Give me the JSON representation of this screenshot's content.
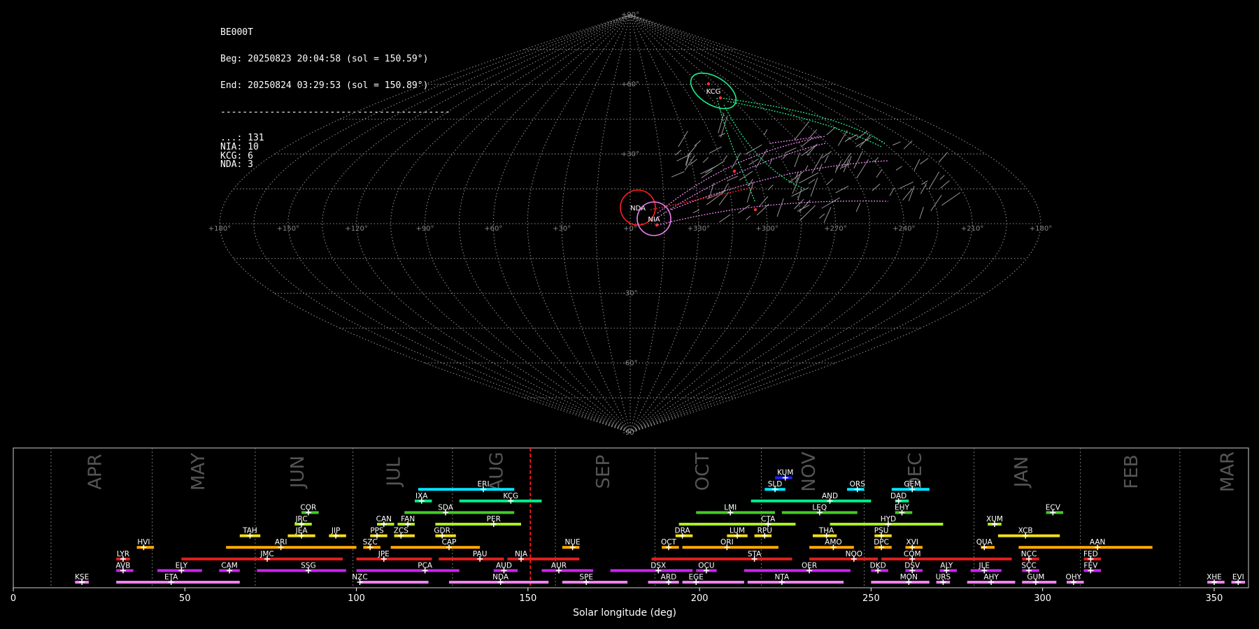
{
  "info_box": {
    "station": "BE000T",
    "begin": "Beg: 20250823 20:04:58 (sol = 150.59°)",
    "end": "End: 20250824 03:29:53 (sol = 150.89°)",
    "separator": "------------------------------------------",
    "counts": [
      {
        "code": "...",
        "count": 131
      },
      {
        "code": "NIA",
        "count": 10
      },
      {
        "code": "KCG",
        "count": 6
      },
      {
        "code": "NDA",
        "count": 3
      }
    ]
  },
  "sky_map": {
    "projection": "sinusoidal",
    "lat_labels": [
      "+90°",
      "+60°",
      "+30°",
      "-30°",
      "-60°",
      "-90°"
    ],
    "lon_labels": [
      "+180°",
      "+150°",
      "+120°",
      "+90°",
      "+60°",
      "+30°",
      "+0°",
      "+330°",
      "+300°",
      "+270°",
      "+240°",
      "+210°",
      "+180°"
    ],
    "radiants": [
      {
        "code": "NDA",
        "color": "#ff2020"
      },
      {
        "code": "NIA",
        "color": "#ee82ee"
      },
      {
        "code": "KCG",
        "color": "#22ee88"
      }
    ]
  },
  "chart_data": {
    "type": "timeline",
    "xlabel": "Solar longitude (deg)",
    "xlim": [
      0,
      360
    ],
    "xticks": [
      0,
      50,
      100,
      150,
      200,
      250,
      300,
      350
    ],
    "current_sol": 150.7,
    "months": [
      {
        "name": "APR",
        "boundary": 11,
        "center": 24
      },
      {
        "name": "MAY",
        "boundary": 40.5,
        "center": 54
      },
      {
        "name": "JUN",
        "boundary": 70.5,
        "center": 83
      },
      {
        "name": "JUL",
        "boundary": 99,
        "center": 111
      },
      {
        "name": "AUG",
        "boundary": 128,
        "center": 141
      },
      {
        "name": "SEP",
        "boundary": 158,
        "center": 172
      },
      {
        "name": "OCT",
        "boundary": 187,
        "center": 201
      },
      {
        "name": "NOV",
        "boundary": 218,
        "center": 232
      },
      {
        "name": "DEC",
        "boundary": 248,
        "center": 263
      },
      {
        "name": "JAN",
        "boundary": 280,
        "center": 294
      },
      {
        "name": "FEB",
        "boundary": 311,
        "center": 326
      },
      {
        "name": "MAR",
        "boundary": 340,
        "center": 354
      }
    ],
    "showers": [
      {
        "code": "KUM",
        "start": 222,
        "end": 227,
        "peak": 225,
        "row": 9,
        "color": "#2020ff"
      },
      {
        "code": "ERI",
        "start": 118,
        "end": 146,
        "peak": 137,
        "row": 8,
        "color": "#00e5ff"
      },
      {
        "code": "SLD",
        "start": 219,
        "end": 225,
        "peak": 222,
        "row": 8,
        "color": "#00e5ff"
      },
      {
        "code": "ORS",
        "start": 243,
        "end": 248,
        "peak": 246,
        "row": 8,
        "color": "#00e5ff"
      },
      {
        "code": "GEM",
        "start": 256,
        "end": 267,
        "peak": 262,
        "row": 8,
        "color": "#00e5ff"
      },
      {
        "code": "IXA",
        "start": 117,
        "end": 122,
        "peak": 119,
        "row": 7,
        "color": "#00ee88"
      },
      {
        "code": "KCG",
        "start": 130,
        "end": 154,
        "peak": 145,
        "row": 7,
        "color": "#00ee88"
      },
      {
        "code": "AND",
        "start": 215,
        "end": 250,
        "peak": 238,
        "row": 7,
        "color": "#00ee88"
      },
      {
        "code": "DAD",
        "start": 257,
        "end": 261,
        "peak": 258,
        "row": 7,
        "color": "#00ee88"
      },
      {
        "code": "COR",
        "start": 84,
        "end": 89,
        "peak": 86,
        "row": 6,
        "color": "#44cc22"
      },
      {
        "code": "SDA",
        "start": 114,
        "end": 146,
        "peak": 126,
        "row": 6,
        "color": "#44cc22"
      },
      {
        "code": "LMI",
        "start": 199,
        "end": 222,
        "peak": 209,
        "row": 6,
        "color": "#44cc22"
      },
      {
        "code": "LEQ",
        "start": 224,
        "end": 246,
        "peak": 235,
        "row": 6,
        "color": "#44cc22"
      },
      {
        "code": "EHY",
        "start": 257,
        "end": 262,
        "peak": 259,
        "row": 6,
        "color": "#44cc22"
      },
      {
        "code": "ECV",
        "start": 301,
        "end": 306,
        "peak": 303,
        "row": 6,
        "color": "#44cc22"
      },
      {
        "code": "JRC",
        "start": 82,
        "end": 87,
        "peak": 84,
        "row": 5,
        "color": "#aaee22"
      },
      {
        "code": "CAN",
        "start": 106,
        "end": 111,
        "peak": 108,
        "row": 5,
        "color": "#aaee22"
      },
      {
        "code": "FAN",
        "start": 112,
        "end": 117,
        "peak": 115,
        "row": 5,
        "color": "#aaee22"
      },
      {
        "code": "PER",
        "start": 123,
        "end": 148,
        "peak": 140,
        "row": 5,
        "color": "#aaee22"
      },
      {
        "code": "CTA",
        "start": 194,
        "end": 228,
        "peak": 220,
        "row": 5,
        "color": "#aaee22"
      },
      {
        "code": "HYD",
        "start": 238,
        "end": 271,
        "peak": 255,
        "row": 5,
        "color": "#aaee22"
      },
      {
        "code": "XUM",
        "start": 284,
        "end": 288,
        "peak": 286,
        "row": 5,
        "color": "#aaee22"
      },
      {
        "code": "TAH",
        "start": 66,
        "end": 72,
        "peak": 69,
        "row": 4,
        "color": "#f2e01a"
      },
      {
        "code": "JEA",
        "start": 80,
        "end": 88,
        "peak": 84,
        "row": 4,
        "color": "#f2e01a"
      },
      {
        "code": "JIP",
        "start": 92,
        "end": 97,
        "peak": 94,
        "row": 4,
        "color": "#f2e01a"
      },
      {
        "code": "PPS",
        "start": 104,
        "end": 109,
        "peak": 106,
        "row": 4,
        "color": "#f2e01a"
      },
      {
        "code": "ZCS",
        "start": 111,
        "end": 117,
        "peak": 113,
        "row": 4,
        "color": "#f2e01a"
      },
      {
        "code": "GDR",
        "start": 123,
        "end": 129,
        "peak": 125,
        "row": 4,
        "color": "#f2e01a"
      },
      {
        "code": "DRA",
        "start": 193,
        "end": 198,
        "peak": 195,
        "row": 4,
        "color": "#f2e01a"
      },
      {
        "code": "LUM",
        "start": 208,
        "end": 214,
        "peak": 211,
        "row": 4,
        "color": "#f2e01a"
      },
      {
        "code": "RPU",
        "start": 216,
        "end": 221,
        "peak": 219,
        "row": 4,
        "color": "#f2e01a"
      },
      {
        "code": "THA",
        "start": 233,
        "end": 240,
        "peak": 237,
        "row": 4,
        "color": "#f2e01a"
      },
      {
        "code": "PSU",
        "start": 251,
        "end": 256,
        "peak": 253,
        "row": 4,
        "color": "#f2e01a"
      },
      {
        "code": "XCB",
        "start": 287,
        "end": 305,
        "peak": 295,
        "row": 4,
        "color": "#f2e01a"
      },
      {
        "code": "HVI",
        "start": 36,
        "end": 41,
        "peak": 38,
        "row": 3,
        "color": "#ffaa00"
      },
      {
        "code": "ARI",
        "start": 62,
        "end": 100,
        "peak": 78,
        "row": 3,
        "color": "#ffaa00"
      },
      {
        "code": "SZC",
        "start": 102,
        "end": 107,
        "peak": 104,
        "row": 3,
        "color": "#ffaa00"
      },
      {
        "code": "CAP",
        "start": 110,
        "end": 136,
        "peak": 127,
        "row": 3,
        "color": "#ffaa00"
      },
      {
        "code": "NUE",
        "start": 160,
        "end": 165,
        "peak": 163,
        "row": 3,
        "color": "#ffaa00"
      },
      {
        "code": "OCT",
        "start": 189,
        "end": 194,
        "peak": 191,
        "row": 3,
        "color": "#ffaa00"
      },
      {
        "code": "ORI",
        "start": 195,
        "end": 223,
        "peak": 208,
        "row": 3,
        "color": "#ffaa00"
      },
      {
        "code": "AMO",
        "start": 232,
        "end": 245,
        "peak": 239,
        "row": 3,
        "color": "#ffaa00"
      },
      {
        "code": "DPC",
        "start": 251,
        "end": 256,
        "peak": 253,
        "row": 3,
        "color": "#ffaa00"
      },
      {
        "code": "XVI",
        "start": 260,
        "end": 265,
        "peak": 262,
        "row": 3,
        "color": "#ffaa00"
      },
      {
        "code": "QUA",
        "start": 282,
        "end": 286,
        "peak": 283,
        "row": 3,
        "color": "#ffaa00"
      },
      {
        "code": "AAN",
        "start": 293,
        "end": 332,
        "peak": 316,
        "row": 3,
        "color": "#ffaa00"
      },
      {
        "code": "LYR",
        "start": 30,
        "end": 34,
        "peak": 32,
        "row": 2,
        "color": "#e02020"
      },
      {
        "code": "JMC",
        "start": 49,
        "end": 96,
        "peak": 74,
        "row": 2,
        "color": "#e02020"
      },
      {
        "code": "JPE",
        "start": 100,
        "end": 122,
        "peak": 108,
        "row": 2,
        "color": "#e02020"
      },
      {
        "code": "PAU",
        "start": 124,
        "end": 143,
        "peak": 136,
        "row": 2,
        "color": "#e02020"
      },
      {
        "code": "NIA",
        "start": 144,
        "end": 165,
        "peak": 148,
        "row": 2,
        "color": "#e02020"
      },
      {
        "code": "STA",
        "start": 186,
        "end": 227,
        "peak": 216,
        "row": 2,
        "color": "#e02020"
      },
      {
        "code": "NOO",
        "start": 232,
        "end": 252,
        "peak": 245,
        "row": 2,
        "color": "#e02020"
      },
      {
        "code": "COM",
        "start": 253,
        "end": 291,
        "peak": 262,
        "row": 2,
        "color": "#e02020"
      },
      {
        "code": "NCC",
        "start": 294,
        "end": 299,
        "peak": 296,
        "row": 2,
        "color": "#e02020"
      },
      {
        "code": "FED",
        "start": 312,
        "end": 317,
        "peak": 314,
        "row": 2,
        "color": "#e02020"
      },
      {
        "code": "AVB",
        "start": 30,
        "end": 35,
        "peak": 32,
        "row": 1,
        "color": "#cc22ee"
      },
      {
        "code": "ELY",
        "start": 42,
        "end": 55,
        "peak": 49,
        "row": 1,
        "color": "#cc22ee"
      },
      {
        "code": "CAM",
        "start": 60,
        "end": 66,
        "peak": 63,
        "row": 1,
        "color": "#cc22ee"
      },
      {
        "code": "SSG",
        "start": 71,
        "end": 97,
        "peak": 86,
        "row": 1,
        "color": "#cc22ee"
      },
      {
        "code": "PCA",
        "start": 100,
        "end": 130,
        "peak": 120,
        "row": 1,
        "color": "#cc22ee"
      },
      {
        "code": "AUD",
        "start": 140,
        "end": 147,
        "peak": 143,
        "row": 1,
        "color": "#cc22ee"
      },
      {
        "code": "AUR",
        "start": 154,
        "end": 169,
        "peak": 159,
        "row": 1,
        "color": "#cc22ee"
      },
      {
        "code": "DSX",
        "start": 174,
        "end": 198,
        "peak": 188,
        "row": 1,
        "color": "#cc22ee"
      },
      {
        "code": "OCU",
        "start": 199,
        "end": 205,
        "peak": 202,
        "row": 1,
        "color": "#cc22ee"
      },
      {
        "code": "OER",
        "start": 213,
        "end": 244,
        "peak": 232,
        "row": 1,
        "color": "#cc22ee"
      },
      {
        "code": "DKD",
        "start": 250,
        "end": 255,
        "peak": 252,
        "row": 1,
        "color": "#cc22ee"
      },
      {
        "code": "DSV",
        "start": 260,
        "end": 265,
        "peak": 262,
        "row": 1,
        "color": "#cc22ee"
      },
      {
        "code": "ALY",
        "start": 270,
        "end": 275,
        "peak": 272,
        "row": 1,
        "color": "#cc22ee"
      },
      {
        "code": "JLE",
        "start": 279,
        "end": 288,
        "peak": 283,
        "row": 1,
        "color": "#cc22ee"
      },
      {
        "code": "SCC",
        "start": 294,
        "end": 299,
        "peak": 296,
        "row": 1,
        "color": "#cc22ee"
      },
      {
        "code": "FEV",
        "start": 312,
        "end": 317,
        "peak": 314,
        "row": 1,
        "color": "#cc22ee"
      },
      {
        "code": "KSE",
        "start": 18,
        "end": 22,
        "peak": 20,
        "row": 0,
        "color": "#ee82ee"
      },
      {
        "code": "ETA",
        "start": 30,
        "end": 66,
        "peak": 46,
        "row": 0,
        "color": "#ee82ee"
      },
      {
        "code": "NZC",
        "start": 101,
        "end": 121,
        "peak": 101,
        "row": 0,
        "color": "#ee82ee"
      },
      {
        "code": "NDA",
        "start": 127,
        "end": 156,
        "peak": 142,
        "row": 0,
        "color": "#ee82ee"
      },
      {
        "code": "SPE",
        "start": 160,
        "end": 179,
        "peak": 167,
        "row": 0,
        "color": "#ee82ee"
      },
      {
        "code": "ARD",
        "start": 185,
        "end": 194,
        "peak": 191,
        "row": 0,
        "color": "#ee82ee"
      },
      {
        "code": "EGE",
        "start": 195,
        "end": 213,
        "peak": 199,
        "row": 0,
        "color": "#ee82ee"
      },
      {
        "code": "NTA",
        "start": 214,
        "end": 242,
        "peak": 224,
        "row": 0,
        "color": "#ee82ee"
      },
      {
        "code": "MON",
        "start": 250,
        "end": 267,
        "peak": 261,
        "row": 0,
        "color": "#ee82ee"
      },
      {
        "code": "URS",
        "start": 269,
        "end": 273,
        "peak": 271,
        "row": 0,
        "color": "#ee82ee"
      },
      {
        "code": "AHY",
        "start": 278,
        "end": 292,
        "peak": 285,
        "row": 0,
        "color": "#ee82ee"
      },
      {
        "code": "GUM",
        "start": 294,
        "end": 304,
        "peak": 298,
        "row": 0,
        "color": "#ee82ee"
      },
      {
        "code": "OHY",
        "start": 307,
        "end": 312,
        "peak": 309,
        "row": 0,
        "color": "#ee82ee"
      },
      {
        "code": "XHE",
        "start": 348,
        "end": 353,
        "peak": 350,
        "row": 0,
        "color": "#ee82ee"
      },
      {
        "code": "EVI",
        "start": 355,
        "end": 359,
        "peak": 357,
        "row": 0,
        "color": "#ee82ee"
      }
    ]
  }
}
